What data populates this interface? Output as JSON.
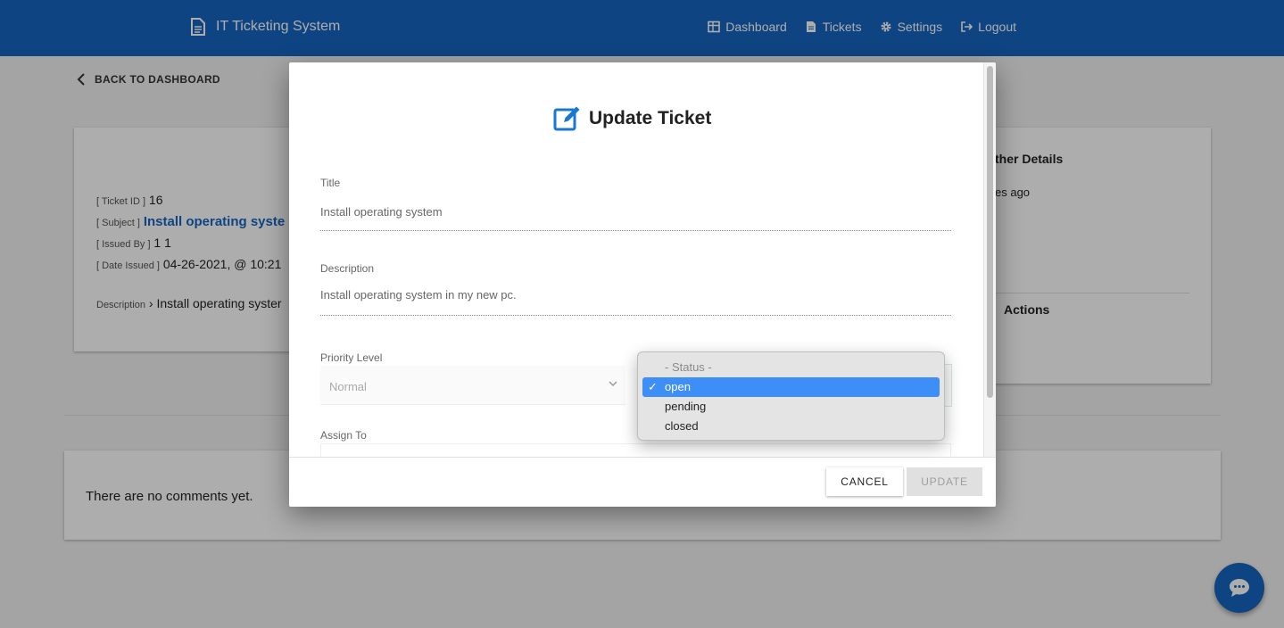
{
  "header": {
    "app_title": "IT Ticketing System",
    "nav": [
      {
        "label": "Dashboard",
        "icon": "dashboard-icon"
      },
      {
        "label": "Tickets",
        "icon": "document-icon"
      },
      {
        "label": "Settings",
        "icon": "gear-icon"
      },
      {
        "label": "Logout",
        "icon": "logout-icon"
      }
    ]
  },
  "back_link": "BACK TO DASHBOARD",
  "ticket": {
    "id_label": "[ Ticket ID ]",
    "id": "16",
    "subject_label": "[ Subject ]",
    "subject": "Install operating syste",
    "issued_by_label": "[ Issued By ]",
    "issued_by": "1 1",
    "date_label": "[ Date Issued ]",
    "date": "04-26-2021, @ 10:21",
    "description_label": "Description",
    "description": "Install operating syster"
  },
  "side": {
    "heading": "ther Details",
    "time_ago": "es ago",
    "actions_heading": "Actions"
  },
  "comments": {
    "empty_text": "There are no comments yet."
  },
  "dialog": {
    "title": "Update Ticket",
    "fields": {
      "title_label": "Title",
      "title_value": "Install operating system",
      "description_label": "Description",
      "description_value": "Install operating system in my new pc.",
      "priority_label": "Priority Level",
      "priority_value": "Normal",
      "assign_label": "Assign To"
    },
    "status_dropdown": {
      "options": [
        "- Status -",
        "open",
        "pending",
        "closed"
      ],
      "selected": "open"
    },
    "cancel_label": "CANCEL",
    "update_label": "UPDATE"
  },
  "colors": {
    "primary": "#1565c0",
    "dropdown_highlight": "#3d8ef7"
  }
}
